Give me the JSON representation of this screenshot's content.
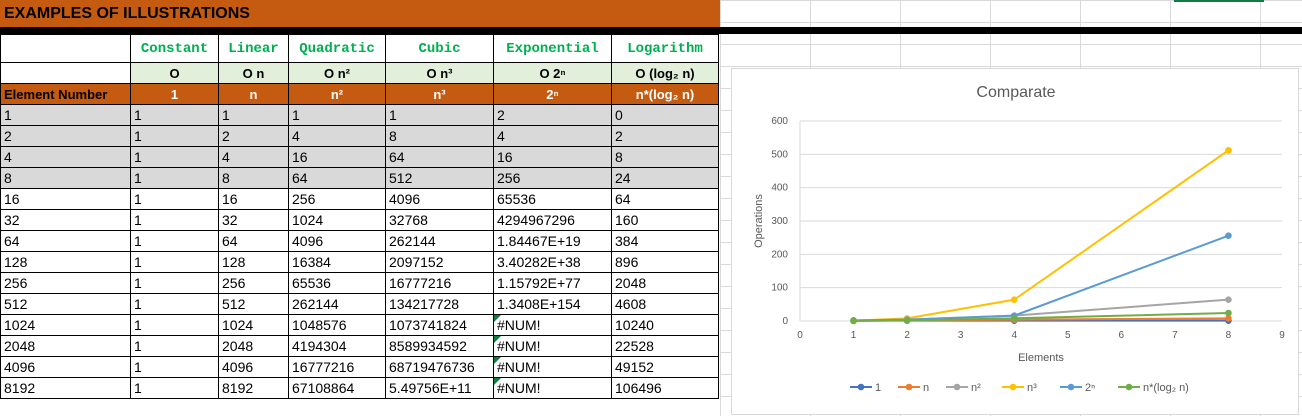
{
  "banner": {
    "title": "EXAMPLES OF ILLUSTRATIONS"
  },
  "table": {
    "complexity_names": [
      "Constant",
      "Linear",
      "Quadratic",
      "Cubic",
      "Exponential",
      "Logarithm"
    ],
    "big_o": [
      "O",
      "O n",
      "O n²",
      "O n³",
      "O 2ⁿ",
      "O (log₂ n)"
    ],
    "sub_header_first": "Element Number",
    "sub_headers": [
      "1",
      "n",
      "n²",
      "n³",
      "2ⁿ",
      "n*(log₂ n)"
    ],
    "gray_rows": 4,
    "error_value": "#NUM!",
    "rows": [
      [
        "1",
        "1",
        "1",
        "1",
        "1",
        "2",
        "0"
      ],
      [
        "2",
        "1",
        "2",
        "4",
        "8",
        "4",
        "2"
      ],
      [
        "4",
        "1",
        "4",
        "16",
        "64",
        "16",
        "8"
      ],
      [
        "8",
        "1",
        "8",
        "64",
        "512",
        "256",
        "24"
      ],
      [
        "16",
        "1",
        "16",
        "256",
        "4096",
        "65536",
        "64"
      ],
      [
        "32",
        "1",
        "32",
        "1024",
        "32768",
        "4294967296",
        "160"
      ],
      [
        "64",
        "1",
        "64",
        "4096",
        "262144",
        "1.84467E+19",
        "384"
      ],
      [
        "128",
        "1",
        "128",
        "16384",
        "2097152",
        "3.40282E+38",
        "896"
      ],
      [
        "256",
        "1",
        "256",
        "65536",
        "16777216",
        "1.15792E+77",
        "2048"
      ],
      [
        "512",
        "1",
        "512",
        "262144",
        "134217728",
        "1.3408E+154",
        "4608"
      ],
      [
        "1024",
        "1",
        "1024",
        "1048576",
        "1073741824",
        "#NUM!",
        "10240"
      ],
      [
        "2048",
        "1",
        "2048",
        "4194304",
        "8589934592",
        "#NUM!",
        "22528"
      ],
      [
        "4096",
        "1",
        "4096",
        "16777216",
        "68719476736",
        "#NUM!",
        "49152"
      ],
      [
        "8192",
        "1",
        "8192",
        "67108864",
        "5.49756E+11",
        "#NUM!",
        "106496"
      ]
    ]
  },
  "chart_data": {
    "type": "scatter",
    "title": "Comparate",
    "xlabel": "Elements",
    "ylabel": "Operations",
    "xlim": [
      0,
      9
    ],
    "ylim": [
      0,
      600
    ],
    "x_ticks": [
      "0",
      "1",
      "2",
      "3",
      "4",
      "5",
      "6",
      "7",
      "8",
      "9"
    ],
    "y_ticks": [
      "0",
      "100",
      "200",
      "300",
      "400",
      "500",
      "600"
    ],
    "grid": true,
    "legend_position": "bottom",
    "x": [
      1,
      2,
      4,
      8
    ],
    "series": [
      {
        "name": "1",
        "values": [
          1,
          1,
          1,
          1
        ],
        "color": "#4472c4"
      },
      {
        "name": "n",
        "values": [
          1,
          2,
          4,
          8
        ],
        "color": "#ed7d31"
      },
      {
        "name": "n²",
        "values": [
          1,
          4,
          16,
          64
        ],
        "color": "#a5a5a5"
      },
      {
        "name": "n³",
        "values": [
          1,
          8,
          64,
          512
        ],
        "color": "#ffc000"
      },
      {
        "name": "2ⁿ",
        "values": [
          2,
          4,
          16,
          256
        ],
        "color": "#5b9bd5"
      },
      {
        "name": "n*(log₂ n)",
        "values": [
          0,
          2,
          8,
          24
        ],
        "color": "#70ad47"
      }
    ]
  }
}
